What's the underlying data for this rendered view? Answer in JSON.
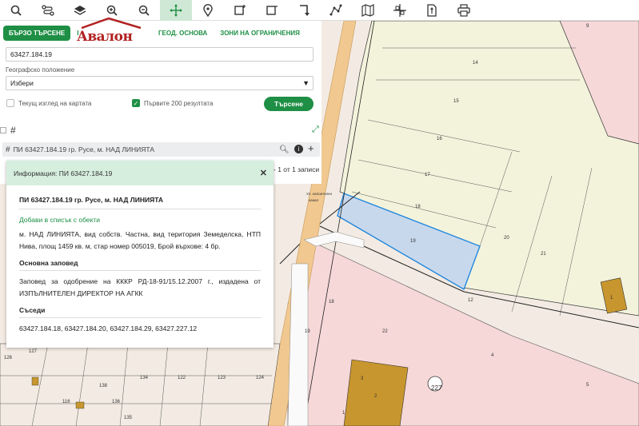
{
  "toolbar": {
    "icons": [
      "search-icon",
      "route-icon",
      "layers-icon",
      "zoom-in-icon",
      "zoom-out-icon",
      "pan-icon",
      "location-pin-icon",
      "draw-rectangle-icon",
      "select-rectangle-icon",
      "turn-icon",
      "polyline-icon",
      "map-icon",
      "crosshair-icon",
      "export-icon",
      "print-icon"
    ],
    "active": "pan-icon"
  },
  "tabs": {
    "quick_search": "БЪРЗО ТЪРСЕНЕ",
    "first_partial": "І",
    "geo_base": "ГЕОД. ОСНОВА",
    "restriction_zones": "ЗОНИ НА ОГРАНИЧЕНИЯ"
  },
  "logo": {
    "text": "Авалон"
  },
  "search": {
    "value": "63427.184.19",
    "location_label": "Географско положение",
    "location_value": "Избери",
    "current_view_label": "Текущ изглед на картата",
    "current_view_checked": false,
    "first200_label": "Първите 200 резултата",
    "first200_checked": true,
    "button": "Търсене"
  },
  "result": {
    "text": "ПИ 63427.184.19 гр. Русе, м. НАД ЛИНИЯТА",
    "pager": "- 1 от 1 записи"
  },
  "info": {
    "header": "Информация: ПИ 63427.184.19",
    "title": "ПИ 63427.184.19 гр. Русе, м. НАД ЛИНИЯТА",
    "add_link": "Добави в списък с обекти",
    "description": "м. НАД ЛИНИЯТА, вид собств. Частна, вид територия Земеделска, НТП Нива, площ 1459 кв. м, стар номер 005019, Брой върхове: 4 бр.",
    "order_heading": "Основна заповед",
    "order_text": "Заповед за одобрение на КККР РД-18-91/15.12.2007 г., издадена от ИЗПЪЛНИТЕЛЕН ДИРЕКТОР НА АГКК",
    "neighbours_heading": "Съседи",
    "neighbours": "63427.184.18, 63427.184.20, 63427.184.29, 63427.227.12"
  },
  "map_labels": [
    "9",
    "14",
    "15",
    "16",
    "17",
    "18",
    "19",
    "20",
    "21",
    "12",
    "22",
    "4",
    "5",
    "3",
    "2",
    "1",
    "227",
    "18",
    "19",
    "1",
    "126",
    "127",
    "116",
    "138",
    "136",
    "135",
    "134",
    "122",
    "123",
    "124"
  ],
  "map_small_text": [
    "Ул. напоителен",
    "канал"
  ],
  "colors": {
    "accent": "#1e8f45",
    "selected_parcel": "#c8d8ec",
    "parcel_outline": "#2288dd",
    "logo": "#b22222"
  }
}
